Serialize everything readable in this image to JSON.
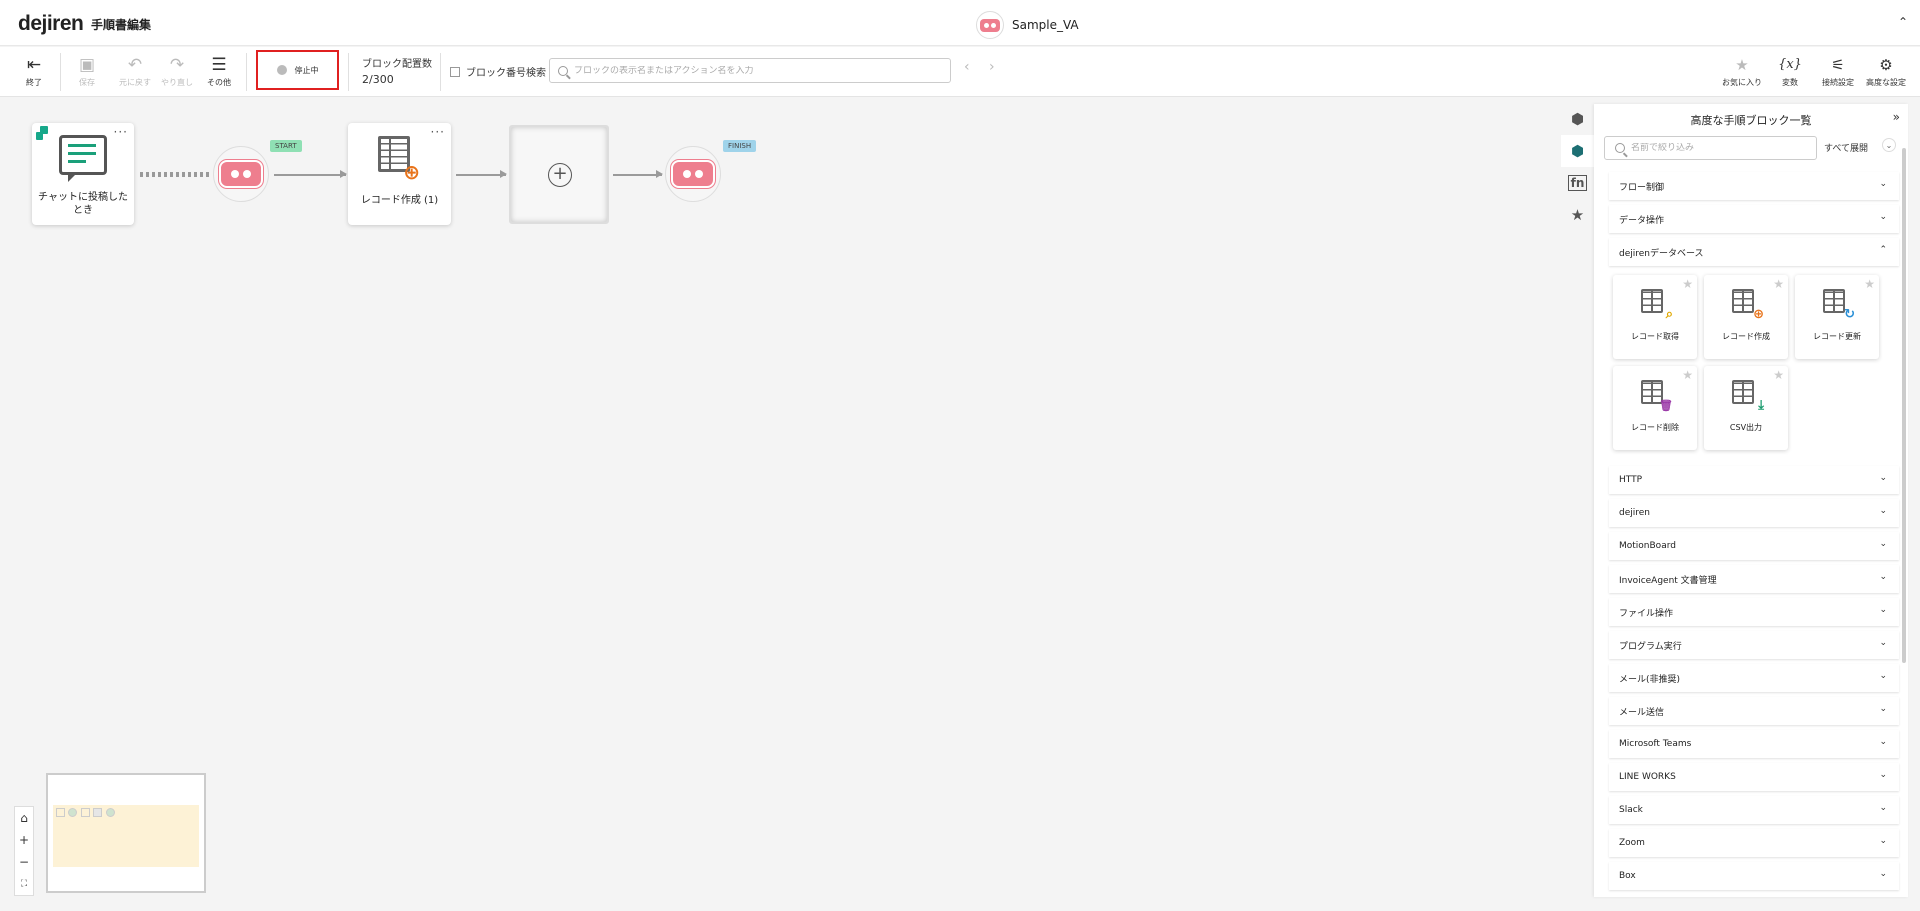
{
  "header": {
    "logo": "dejiren",
    "page_title": "手順書編集",
    "robot_name": "Sample_VA",
    "collapse_icon": "⌃"
  },
  "toolbar": {
    "exit": "終了",
    "save": "保存",
    "undo": "元に戻す",
    "redo": "やり直し",
    "other": "その他",
    "status": "停止中",
    "block_count_label": "ブロック配置数",
    "block_count_value": "2/300",
    "block_number_search": "ブロック番号検索",
    "search_placeholder": "ブロックの表示名またはアクション名を入力",
    "favorites": "お気に入り",
    "variables": "変数",
    "connection_settings": "接続設定",
    "advanced_settings": "高度な設定",
    "variables_glyph": "{x}"
  },
  "canvas": {
    "trigger_label": "チャットに投稿したとき",
    "start_tag": "START",
    "finish_tag": "FINISH",
    "record_create_label": "レコード作成 (1)",
    "more_glyph": "···"
  },
  "panel": {
    "title": "高度な手順ブロック一覧",
    "search_placeholder": "名前で絞り込み",
    "expand_all": "すべて展開",
    "categories": [
      "フロー制御",
      "データ操作",
      "dejirenデータベース",
      "HTTP",
      "dejiren",
      "MotionBoard",
      "InvoiceAgent 文書管理",
      "ファイル操作",
      "プログラム実行",
      "メール(非推奨)",
      "メール送信",
      "Microsoft Teams",
      "LINE WORKS",
      "Slack",
      "Zoom",
      "Box"
    ],
    "db_blocks": [
      {
        "label": "レコード取得",
        "overlay": "⌕",
        "color": "#e0a800"
      },
      {
        "label": "レコード作成",
        "overlay": "⊕",
        "color": "#e8731a"
      },
      {
        "label": "レコード更新",
        "overlay": "↻",
        "color": "#2a8fd6"
      },
      {
        "label": "レコード削除",
        "overlay": "🗑",
        "color": "#9b3aa8"
      },
      {
        "label": "CSV出力",
        "overlay": "⤓",
        "color": "#1a9b6e"
      }
    ]
  },
  "colors": {
    "accent": "#1d6f73",
    "status_border": "#e02020",
    "robot": "#ee7e8e",
    "start_tag": "#8fe0b4",
    "finish_tag": "#9fd3ea"
  }
}
